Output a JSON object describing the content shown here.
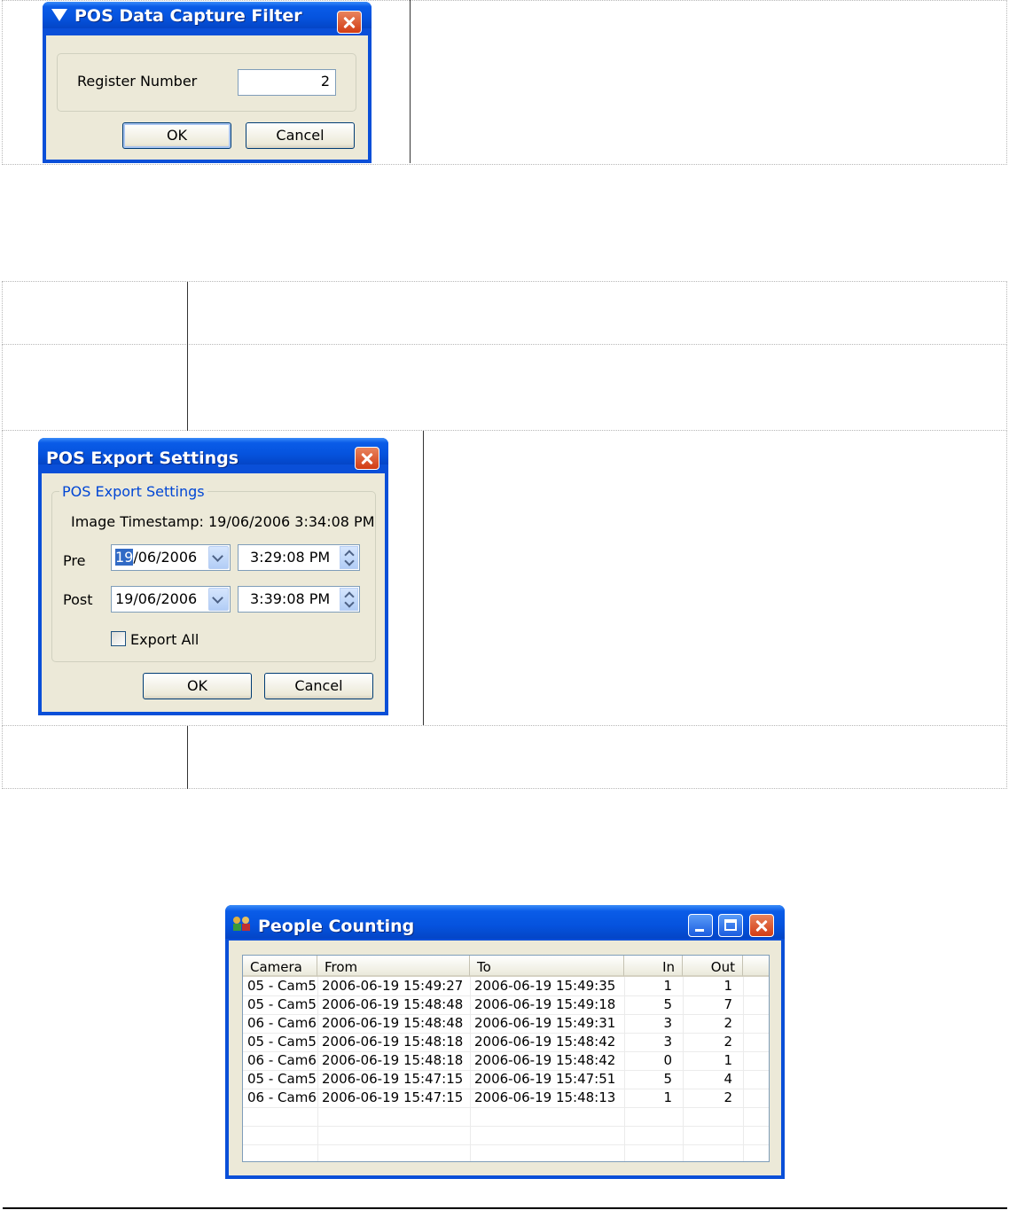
{
  "pos_filter": {
    "title": "POS Data Capture Filter",
    "register_label": "Register Number",
    "register_value": "2",
    "ok": "OK",
    "cancel": "Cancel"
  },
  "pos_export": {
    "title": "POS Export Settings",
    "group_label": "POS Export Settings",
    "timestamp": "Image Timestamp: 19/06/2006 3:34:08 PM",
    "pre_label": "Pre",
    "pre_date_sel": "19",
    "pre_date_rest": "/06/2006",
    "pre_time": "3:29:08 PM",
    "post_label": "Post",
    "post_date": "19/06/2006",
    "post_time": "3:39:08 PM",
    "export_all": "Export All",
    "ok": "OK",
    "cancel": "Cancel"
  },
  "people": {
    "title": "People Counting",
    "headers": [
      "Camera",
      "From",
      "To",
      "In",
      "Out"
    ],
    "rows": [
      [
        "05 - Cam5",
        "2006-06-19 15:49:27",
        "2006-06-19 15:49:35",
        "1",
        "1"
      ],
      [
        "05 - Cam5",
        "2006-06-19 15:48:48",
        "2006-06-19 15:49:18",
        "5",
        "7"
      ],
      [
        "06 - Cam6",
        "2006-06-19 15:48:48",
        "2006-06-19 15:49:31",
        "3",
        "2"
      ],
      [
        "05 - Cam5",
        "2006-06-19 15:48:18",
        "2006-06-19 15:48:42",
        "3",
        "2"
      ],
      [
        "06 - Cam6",
        "2006-06-19 15:48:18",
        "2006-06-19 15:48:42",
        "0",
        "1"
      ],
      [
        "05 - Cam5",
        "2006-06-19 15:47:15",
        "2006-06-19 15:47:51",
        "5",
        "4"
      ],
      [
        "06 - Cam6",
        "2006-06-19 15:47:15",
        "2006-06-19 15:48:13",
        "1",
        "2"
      ]
    ]
  },
  "colors": {
    "xp_blue": "#0a4fd8",
    "xp_face": "#ece9d8",
    "selection": "#316ac5"
  }
}
